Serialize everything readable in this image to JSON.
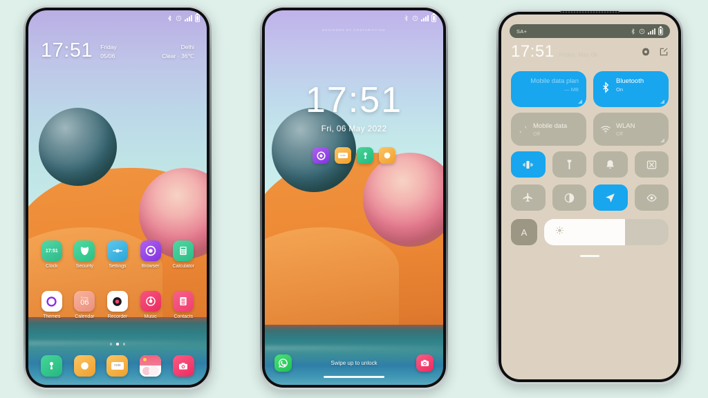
{
  "background_color": "#dff0ea",
  "phones": {
    "home_screen": {
      "name": "home-screen-phone",
      "status_bar": {
        "icons": [
          "bluetooth-icon",
          "alarm-icon",
          "signal-icon",
          "battery-icon"
        ]
      },
      "clock_widget": {
        "time": "17:51",
        "weekday": "Friday",
        "date": "05/06",
        "city": "Delhi",
        "weather": "Clear · 36℃"
      },
      "app_rows": [
        [
          {
            "label": "Clock",
            "icon": "clock-icon",
            "badge": "17:51",
            "color": "#3fcb9b"
          },
          {
            "label": "Security",
            "icon": "security-icon",
            "color": "#35c98d"
          },
          {
            "label": "Settings",
            "icon": "settings-icon",
            "color": "#3fb8e0"
          },
          {
            "label": "Browser",
            "icon": "browser-icon",
            "color": "#9b45e8"
          },
          {
            "label": "Calculator",
            "icon": "calculator-icon",
            "color": "#3ecb9a"
          }
        ],
        [
          {
            "label": "Themes",
            "icon": "themes-icon",
            "color": "#ffffff"
          },
          {
            "label": "Calendar",
            "icon": "calendar-icon",
            "badge": "06",
            "sub": "Friday",
            "color": "#f4a58c"
          },
          {
            "label": "Recorder",
            "icon": "recorder-icon",
            "color": "#ffffff"
          },
          {
            "label": "Music",
            "icon": "music-icon",
            "color": "#f2436f"
          },
          {
            "label": "Contacts",
            "icon": "contacts-icon",
            "color": "#f2547d"
          }
        ]
      ],
      "page_indicator": {
        "count": 3,
        "active_index": 1
      },
      "dock": [
        {
          "label": "Mi Remote",
          "icon": "remote-icon",
          "color": "#34c98c"
        },
        {
          "label": "Messages",
          "icon": "messages-icon",
          "color": "#f5b23e"
        },
        {
          "label": "Notes",
          "icon": "notes-icon",
          "text": "note",
          "color": "#f5b23e"
        },
        {
          "label": "Gallery",
          "icon": "gallery-icon",
          "color": "#ffffff"
        },
        {
          "label": "Camera",
          "icon": "camera-icon",
          "color": "#f4426f"
        }
      ]
    },
    "lock_screen": {
      "name": "lock-screen-phone",
      "watermark": "DESIGNED BY CGSTARIFFING",
      "status_bar": {
        "icons": [
          "bluetooth-icon",
          "alarm-icon",
          "signal-icon",
          "battery-icon"
        ]
      },
      "clock": {
        "time": "17:51",
        "date": "Fri, 06 May 2022"
      },
      "shortcuts": [
        {
          "label": "Browser",
          "icon": "browser-icon",
          "color": "#9b45e8"
        },
        {
          "label": "Notes",
          "icon": "notes-icon",
          "color": "#f5b23e"
        },
        {
          "label": "Mi Remote",
          "icon": "remote-icon",
          "color": "#34c98c"
        },
        {
          "label": "Messages",
          "icon": "messages-icon",
          "color": "#f5b23e"
        }
      ],
      "bottom": {
        "left_app": {
          "label": "WhatsApp",
          "icon": "whatsapp-icon",
          "color": "#25d366"
        },
        "hint": "Swipe up to unlock",
        "right_app": {
          "label": "Camera",
          "icon": "camera-icon",
          "color": "#f4426f"
        }
      }
    },
    "control_center": {
      "name": "control-center-phone",
      "status_bar": {
        "carrier": "SA+",
        "icons": [
          "bluetooth-icon",
          "alarm-icon",
          "signal-icon",
          "battery-icon"
        ]
      },
      "clock": {
        "time": "17:51",
        "date": "Friday, May 06"
      },
      "header_icons": [
        "gear-icon",
        "edit-icon"
      ],
      "big_tiles": [
        {
          "title": "Mobile data plan",
          "subtitle": "— MB",
          "icon": "data-plan-icon",
          "state": "on"
        },
        {
          "title": "Bluetooth",
          "subtitle": "On",
          "icon": "bluetooth-icon",
          "state": "on"
        }
      ],
      "medium_tiles": [
        {
          "title": "Mobile data",
          "subtitle": "Off",
          "icon": "mobile-data-icon",
          "state": "off"
        },
        {
          "title": "WLAN",
          "subtitle": "Off",
          "icon": "wlan-icon",
          "state": "off"
        }
      ],
      "toggle_rows": [
        [
          {
            "label": "Vibrate",
            "icon": "vibrate-icon",
            "state": "on"
          },
          {
            "label": "Flashlight",
            "icon": "flashlight-icon",
            "state": "off"
          },
          {
            "label": "Notifications",
            "icon": "bell-icon",
            "state": "off"
          },
          {
            "label": "Screenshot",
            "icon": "screenshot-icon",
            "state": "off"
          }
        ],
        [
          {
            "label": "Airplane mode",
            "icon": "airplane-icon",
            "state": "off"
          },
          {
            "label": "Dark mode",
            "icon": "dark-mode-icon",
            "state": "off"
          },
          {
            "label": "Location",
            "icon": "location-icon",
            "state": "on"
          },
          {
            "label": "Reading mode",
            "icon": "eye-icon",
            "state": "off"
          }
        ]
      ],
      "brightness": {
        "auto_label": "A",
        "icon": "brightness-icon",
        "value_percent": 65
      },
      "accent_color": "#18a6ee",
      "panel_color": "#ddd2c1"
    }
  }
}
